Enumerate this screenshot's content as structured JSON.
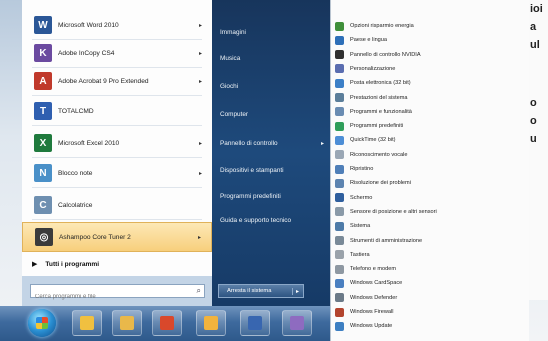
{
  "desktop_right_text": [
    "ioi",
    "a",
    "ul",
    "",
    "o",
    "o",
    "u"
  ],
  "left_pane": {
    "programs": [
      {
        "label": "Microsoft Word 2010",
        "icon": "word-icon",
        "color": "#2b5797",
        "glyph": "W",
        "arrow": "▸"
      },
      {
        "label": "Adobe InCopy CS4",
        "icon": "incopy-icon",
        "color": "#6b4aa0",
        "glyph": "K",
        "arrow": "▸"
      },
      {
        "label": "Adobe Acrobat 9 Pro Extended",
        "icon": "acrobat-icon",
        "color": "#c0392b",
        "glyph": "A",
        "arrow": "▸"
      },
      {
        "label": "TOTALCMD",
        "icon": "totalcmd-icon",
        "color": "#2f5fb0",
        "glyph": "T",
        "arrow": ""
      },
      {
        "label": "Microsoft Excel 2010",
        "icon": "excel-icon",
        "color": "#1f7a3d",
        "glyph": "X",
        "arrow": "▸"
      },
      {
        "label": "Blocco note",
        "icon": "notepad-icon",
        "color": "#4a90c8",
        "glyph": "N",
        "arrow": "▸"
      },
      {
        "label": "Calcolatrice",
        "icon": "calculator-icon",
        "color": "#6e8fb0",
        "glyph": "C",
        "arrow": ""
      },
      {
        "label": "Ashampoo Core Tuner 2",
        "icon": "ashampoo-icon",
        "color": "#3b3b3b",
        "glyph": "◎",
        "arrow": "▸"
      }
    ],
    "all_programs": "Tutti i programmi",
    "search_placeholder": "Cerca programmi e file"
  },
  "right_pane": {
    "items": [
      {
        "label": "Immagini",
        "arrow": ""
      },
      {
        "label": "Musica",
        "arrow": ""
      },
      {
        "label": "Giochi",
        "arrow": ""
      },
      {
        "label": "Computer",
        "arrow": ""
      },
      {
        "label": "Pannello di controllo",
        "arrow": "▸"
      },
      {
        "label": "Dispositivi e stampanti",
        "arrow": ""
      },
      {
        "label": "Programmi predefiniti",
        "arrow": ""
      },
      {
        "label": "Guida e supporto tecnico",
        "arrow": ""
      }
    ],
    "shutdown_label": "Arresta il sistema",
    "shutdown_arrow": "▸"
  },
  "submenu": {
    "items": [
      {
        "label": "Opzioni risparmio energia",
        "color": "#3f8f3a"
      },
      {
        "label": "Paese e lingua",
        "color": "#2d6fb8"
      },
      {
        "label": "Pannello di controllo NVIDIA",
        "color": "#2f2f2f"
      },
      {
        "label": "Personalizzazione",
        "color": "#5a6db0"
      },
      {
        "label": "Posta elettronica (32 bit)",
        "color": "#3c7fc7"
      },
      {
        "label": "Prestazioni del sistema",
        "color": "#5b7e9a"
      },
      {
        "label": "Programmi e funzionalità",
        "color": "#6a8cb2"
      },
      {
        "label": "Programmi predefiniti",
        "color": "#2f9e5a"
      },
      {
        "label": "QuickTime (32 bit)",
        "color": "#4d8ed6"
      },
      {
        "label": "Riconoscimento vocale",
        "color": "#9aa7b5"
      },
      {
        "label": "Ripristino",
        "color": "#4f7fb8"
      },
      {
        "label": "Risoluzione dei problemi",
        "color": "#5d84b0"
      },
      {
        "label": "Schermo",
        "color": "#2f5f9e"
      },
      {
        "label": "Sensore di posizione e altri sensori",
        "color": "#8a9aa8"
      },
      {
        "label": "Sistema",
        "color": "#4e7ba8"
      },
      {
        "label": "Strumenti di amministrazione",
        "color": "#7a8a98"
      },
      {
        "label": "Tastiera",
        "color": "#9aa2aa"
      },
      {
        "label": "Telefono e modem",
        "color": "#8e98a2"
      },
      {
        "label": "Windows CardSpace",
        "color": "#4a7fc0"
      },
      {
        "label": "Windows Defender",
        "color": "#6b7a88"
      },
      {
        "label": "Windows Firewall",
        "color": "#b3442e"
      },
      {
        "label": "Windows Update",
        "color": "#3d7fc2"
      }
    ]
  },
  "taskbar": {
    "buttons": [
      {
        "name": "explorer-icon",
        "color": "#f0c040"
      },
      {
        "name": "folder-icon",
        "color": "#e9b84a"
      },
      {
        "name": "chrome-icon",
        "color": "#d9482b"
      },
      {
        "name": "explorer-window-icon",
        "color": "#f2b33d"
      },
      {
        "name": "save-icon",
        "color": "#3866b0"
      },
      {
        "name": "app-icon",
        "color": "#8e6bc0"
      }
    ]
  }
}
